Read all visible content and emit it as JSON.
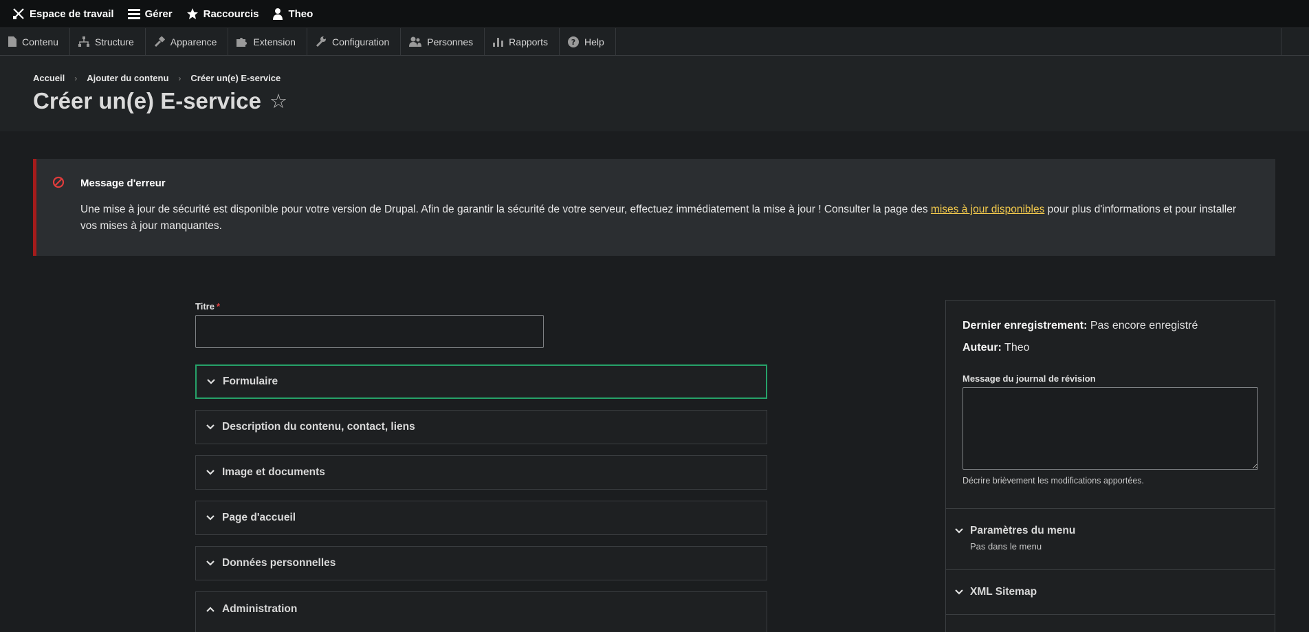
{
  "toolbar": {
    "items": [
      {
        "label": "Espace de travail",
        "icon": "tools-icon"
      },
      {
        "label": "Gérer",
        "icon": "hamburger-icon"
      },
      {
        "label": "Raccourcis",
        "icon": "star-icon"
      },
      {
        "label": "Theo",
        "icon": "user-icon"
      }
    ]
  },
  "tray": {
    "items": [
      {
        "label": "Contenu",
        "icon": "file-icon"
      },
      {
        "label": "Structure",
        "icon": "sitemap-icon"
      },
      {
        "label": "Apparence",
        "icon": "brush-icon"
      },
      {
        "label": "Extension",
        "icon": "puzzle-icon"
      },
      {
        "label": "Configuration",
        "icon": "wrench-icon"
      },
      {
        "label": "Personnes",
        "icon": "people-icon"
      },
      {
        "label": "Rapports",
        "icon": "bar-chart-icon"
      },
      {
        "label": "Help",
        "icon": "help-icon"
      }
    ]
  },
  "breadcrumb": {
    "items": [
      "Accueil",
      "Ajouter du contenu",
      "Créer un(e) E-service"
    ],
    "separator": "›"
  },
  "page": {
    "title": "Créer un(e) E-service",
    "star": "☆"
  },
  "error": {
    "title": "Message d'erreur",
    "text_before": "Une mise à jour de sécurité est disponible pour votre version de Drupal. Afin de garantir la sécurité de votre serveur, effectuez immédiatement la mise à jour ! Consulter la page des ",
    "link": "mises à jour disponibles",
    "text_after": " pour plus d'informations et pour installer vos mises à jour manquantes.",
    "accent_color": "#a51b1b",
    "link_color": "#f2c94c"
  },
  "form": {
    "title_label": "Titre",
    "required_mark": "*",
    "title_value": "",
    "sections": [
      {
        "label": "Formulaire",
        "state": "collapsed",
        "focused": true
      },
      {
        "label": "Description du contenu, contact, liens",
        "state": "collapsed"
      },
      {
        "label": "Image et documents",
        "state": "collapsed"
      },
      {
        "label": "Page d'accueil",
        "state": "collapsed"
      },
      {
        "label": "Données personnelles",
        "state": "collapsed"
      },
      {
        "label": "Administration",
        "state": "expanded"
      }
    ],
    "focus_color": "#26a269"
  },
  "sidebar": {
    "last_saved_label": "Dernier enregistrement:",
    "last_saved_value": "Pas encore enregistré",
    "author_label": "Auteur:",
    "author_value": "Theo",
    "revision_label": "Message du journal de révision",
    "revision_value": "",
    "revision_help": "Décrire brièvement les modifications apportées.",
    "sections": [
      {
        "label": "Paramètres du menu",
        "summary": "Pas dans le menu"
      },
      {
        "label": "XML Sitemap",
        "summary": ""
      }
    ]
  }
}
